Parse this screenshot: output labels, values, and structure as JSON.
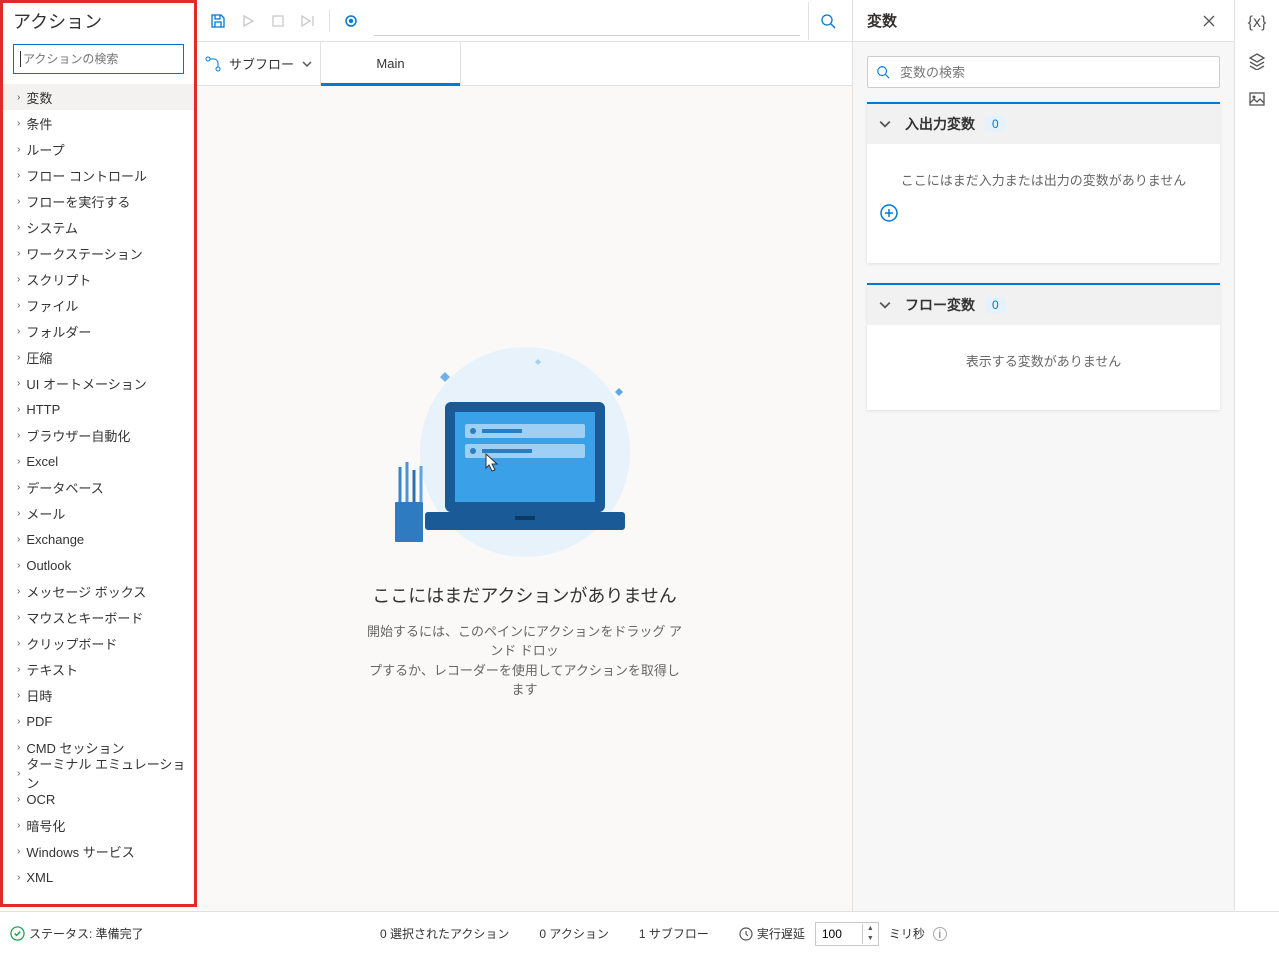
{
  "actions_panel": {
    "title": "アクション",
    "search_placeholder": "アクションの検索",
    "items": [
      "変数",
      "条件",
      "ループ",
      "フロー コントロール",
      "フローを実行する",
      "システム",
      "ワークステーション",
      "スクリプト",
      "ファイル",
      "フォルダー",
      "圧縮",
      "UI オートメーション",
      "HTTP",
      "ブラウザー自動化",
      "Excel",
      "データベース",
      "メール",
      "Exchange",
      "Outlook",
      "メッセージ ボックス",
      "マウスとキーボード",
      "クリップボード",
      "テキスト",
      "日時",
      "PDF",
      "CMD セッション",
      "ターミナル エミュレーション",
      "OCR",
      "暗号化",
      "Windows サービス",
      "XML"
    ]
  },
  "tabs": {
    "subflow_label": "サブフロー",
    "main": "Main"
  },
  "empty_state": {
    "title": "ここにはまだアクションがありません",
    "sub1": "開始するには、このペインにアクションをドラッグ アンド ドロッ",
    "sub2": "プするか、レコーダーを使用してアクションを取得します"
  },
  "vars_panel": {
    "title": "変数",
    "search_placeholder": "変数の検索",
    "io_vars": {
      "label": "入出力変数",
      "count": "0",
      "empty_text": "ここにはまだ入力または出力の変数がありません"
    },
    "flow_vars": {
      "label": "フロー変数",
      "count": "0",
      "empty_text": "表示する変数がありません"
    }
  },
  "status_bar": {
    "status": "ステータス: 準備完了",
    "selected": "0 選択されたアクション",
    "actions": "0 アクション",
    "subflows": "1 サブフロー",
    "delay_label": "実行遅延",
    "delay_value": "100",
    "delay_unit": "ミリ秒"
  }
}
